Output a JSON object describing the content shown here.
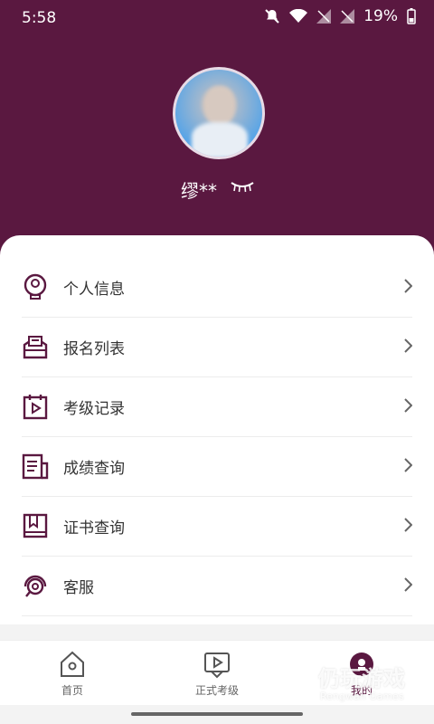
{
  "status_bar": {
    "time": "5:58",
    "battery": "19%"
  },
  "profile": {
    "username": "缪**"
  },
  "menu": [
    {
      "label": "个人信息",
      "icon": "user-info-icon"
    },
    {
      "label": "报名列表",
      "icon": "registration-list-icon"
    },
    {
      "label": "考级记录",
      "icon": "exam-record-icon"
    },
    {
      "label": "成绩查询",
      "icon": "score-query-icon"
    },
    {
      "label": "证书查询",
      "icon": "certificate-query-icon"
    },
    {
      "label": "客服",
      "icon": "customer-service-icon"
    }
  ],
  "tabbar": [
    {
      "label": "首页",
      "icon": "home-icon",
      "active": false
    },
    {
      "label": "正式考级",
      "icon": "exam-play-icon",
      "active": false
    },
    {
      "label": "我的",
      "icon": "profile-icon",
      "active": true
    }
  ],
  "watermark": {
    "text": "仍玩游戏",
    "sub": "Rengwan Games"
  },
  "colors": {
    "brand": "#5a1840",
    "background": "#f3f3f3"
  }
}
